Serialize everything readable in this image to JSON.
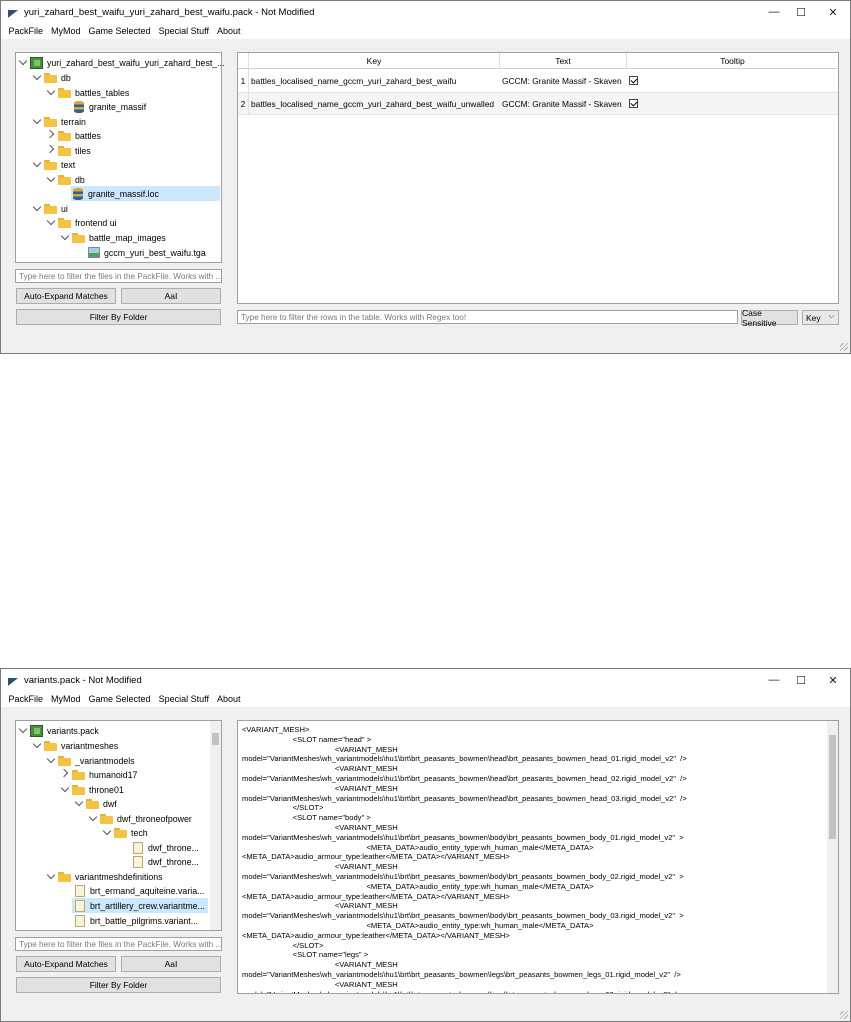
{
  "window1": {
    "title": "yuri_zahard_best_waifu_yuri_zahard_best_waifu.pack - Not Modified",
    "menu": [
      "PackFile",
      "MyMod",
      "Game Selected",
      "Special Stuff",
      "About"
    ],
    "tree": [
      {
        "label": "yuri_zahard_best_waifu_yuri_zahard_best_...",
        "icon": "pack-icon"
      },
      {
        "label": "db",
        "icon": "folder-icon"
      },
      {
        "label": "battles_tables",
        "icon": "folder-icon"
      },
      {
        "label": "granite_massif",
        "icon": "db-icon"
      },
      {
        "label": "terrain",
        "icon": "folder-icon"
      },
      {
        "label": "battles",
        "icon": "folder-icon"
      },
      {
        "label": "tiles",
        "icon": "folder-icon"
      },
      {
        "label": "text",
        "icon": "folder-icon"
      },
      {
        "label": "db",
        "icon": "folder-icon"
      },
      {
        "label": "granite_massif.loc",
        "icon": "db-icon",
        "selected": true
      },
      {
        "label": "ui",
        "icon": "folder-icon"
      },
      {
        "label": "frontend ui",
        "icon": "folder-icon"
      },
      {
        "label": "battle_map_images",
        "icon": "folder-icon"
      },
      {
        "label": "gccm_yuri_best_waifu.tga",
        "icon": "image-icon"
      }
    ],
    "filter_placeholder": "Type here to filter the files in the PackFile. Works with ...",
    "auto_expand": "Auto-Expand Matches",
    "case_btn": "AaI",
    "filter_by_folder": "Filter By Folder",
    "table": {
      "headers": [
        "Key",
        "Text",
        "Tooltip"
      ],
      "rows": [
        {
          "num": "1",
          "key": "battles_localised_name_gccm_yuri_zahard_best_waifu",
          "text": "GCCM: Granite Massif - Skaven",
          "tooltip": true
        },
        {
          "num": "2",
          "key": "battles_localised_name_gccm_yuri_zahard_best_waifu_unwalled",
          "text": "GCCM: Granite Massif - Skaven",
          "tooltip": true
        }
      ]
    },
    "row_filter_placeholder": "Type here to filter the rows in the table. Works with Regex too!",
    "case_sensitive": "Case Sensitive",
    "column_select": "Key"
  },
  "window2": {
    "title": "variants.pack - Not Modified",
    "menu": [
      "PackFile",
      "MyMod",
      "Game Selected",
      "Special Stuff",
      "About"
    ],
    "tree": [
      {
        "label": "variants.pack",
        "icon": "pack-icon"
      },
      {
        "label": "variantmeshes",
        "icon": "folder-icon"
      },
      {
        "label": "_variantmodels",
        "icon": "folder-icon"
      },
      {
        "label": "humanoid17",
        "icon": "folder-icon"
      },
      {
        "label": "throne01",
        "icon": "folder-icon"
      },
      {
        "label": "dwf",
        "icon": "folder-icon"
      },
      {
        "label": "dwf_throneofpower",
        "icon": "folder-icon"
      },
      {
        "label": "tech",
        "icon": "folder-icon"
      },
      {
        "label": "dwf_throne...",
        "icon": "file-icon"
      },
      {
        "label": "dwf_throne...",
        "icon": "file-icon"
      },
      {
        "label": "variantmeshdefinitions",
        "icon": "folder-icon"
      },
      {
        "label": "brt_ermand_aquiteine.varia...",
        "icon": "file-icon"
      },
      {
        "label": "brt_artillery_crew.variantme...",
        "icon": "file-icon",
        "selected": true
      },
      {
        "label": "brt_battle_pilgrims.variant...",
        "icon": "file-icon"
      }
    ],
    "filter_placeholder": "Type here to filter the files in the PackFile. Works with ...",
    "auto_expand": "Auto-Expand Matches",
    "case_btn": "AaI",
    "filter_by_folder": "Filter By Folder",
    "code_lines": [
      "<VARIANT_MESH>",
      "                        <SLOT name=\"head\" >",
      "                                            <VARIANT_MESH",
      "model=\"VariantMeshes\\wh_variantmodels\\hu1\\brt\\brt_peasants_bowmen\\head\\brt_peasants_bowmen_head_01.rigid_model_v2\"  />",
      "                                            <VARIANT_MESH",
      "model=\"VariantMeshes\\wh_variantmodels\\hu1\\brt\\brt_peasants_bowmen\\head\\brt_peasants_bowmen_head_02.rigid_model_v2\"  />",
      "                                            <VARIANT_MESH",
      "model=\"VariantMeshes\\wh_variantmodels\\hu1\\brt\\brt_peasants_bowmen\\head\\brt_peasants_bowmen_head_03.rigid_model_v2\"  />",
      "                        </SLOT>",
      "                        <SLOT name=\"body\" >",
      "                                            <VARIANT_MESH",
      "model=\"VariantMeshes\\wh_variantmodels\\hu1\\brt\\brt_peasants_bowmen\\body\\brt_peasants_bowmen_body_01.rigid_model_v2\"  >",
      "                                                           <META_DATA>audio_entity_type:wh_human_male</META_DATA>",
      "<META_DATA>audio_armour_type:leather</META_DATA></VARIANT_MESH>",
      "                                            <VARIANT_MESH",
      "model=\"VariantMeshes\\wh_variantmodels\\hu1\\brt\\brt_peasants_bowmen\\body\\brt_peasants_bowmen_body_02.rigid_model_v2\"  >",
      "                                                           <META_DATA>audio_entity_type:wh_human_male</META_DATA>",
      "<META_DATA>audio_armour_type:leather</META_DATA></VARIANT_MESH>",
      "                                            <VARIANT_MESH",
      "model=\"VariantMeshes\\wh_variantmodels\\hu1\\brt\\brt_peasants_bowmen\\body\\brt_peasants_bowmen_body_03.rigid_model_v2\"  >",
      "                                                           <META_DATA>audio_entity_type:wh_human_male</META_DATA>",
      "<META_DATA>audio_armour_type:leather</META_DATA></VARIANT_MESH>",
      "                        </SLOT>",
      "                        <SLOT name=\"legs\" >",
      "                                            <VARIANT_MESH",
      "model=\"VariantMeshes\\wh_variantmodels\\hu1\\brt\\brt_peasants_bowmen\\legs\\brt_peasants_bowmen_legs_01.rigid_model_v2\"  />",
      "                                            <VARIANT_MESH",
      "model=\"VariantMeshes\\wh_variantmodels\\hu1\\brt\\brt_peasants_bowmen\\legs\\brt_peasants_bowmen_legs_02.rigid_model_v2\"  />"
    ]
  },
  "controls": {
    "minimize": "—",
    "maximize": "☐",
    "close": "✕"
  },
  "colors": {
    "selection": "#cce8ff",
    "folder": "#f5c342",
    "window_bg": "#f0f0f0"
  }
}
